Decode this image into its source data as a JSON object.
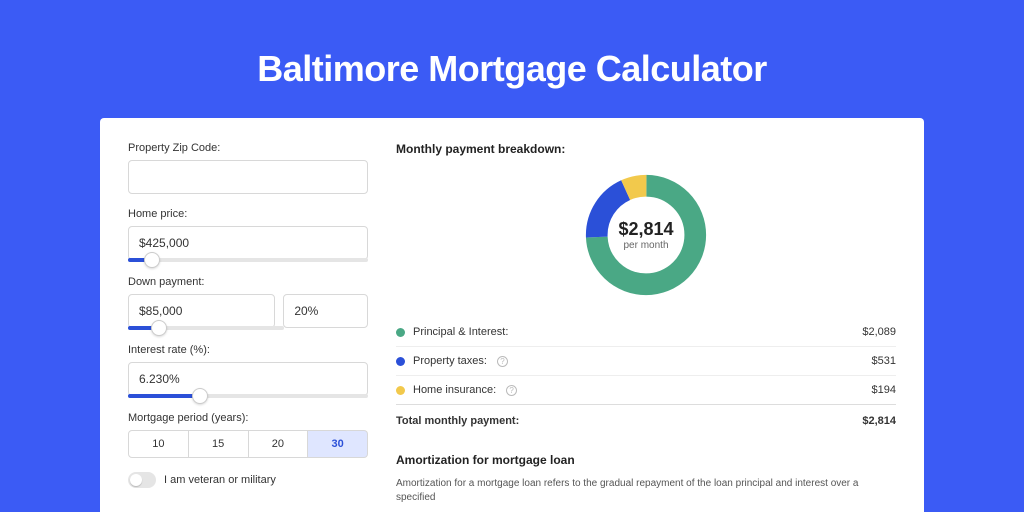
{
  "title": "Baltimore Mortgage Calculator",
  "form": {
    "zip_label": "Property Zip Code:",
    "zip_value": "",
    "home_price_label": "Home price:",
    "home_price_value": "$425,000",
    "home_price_slider_pct": 10,
    "down_payment_label": "Down payment:",
    "down_payment_value": "$85,000",
    "down_payment_pct": "20%",
    "down_payment_slider_pct": 20,
    "interest_label": "Interest rate (%):",
    "interest_value": "6.230%",
    "interest_slider_pct": 30,
    "period_label": "Mortgage period (years):",
    "periods": [
      "10",
      "15",
      "20",
      "30"
    ],
    "period_selected": "30",
    "veteran_label": "I am veteran or military"
  },
  "breakdown": {
    "heading": "Monthly payment breakdown:",
    "center_amount": "$2,814",
    "center_sub": "per month",
    "items": [
      {
        "label": "Principal & Interest:",
        "value": "$2,089",
        "color": "#4aa885",
        "info": false
      },
      {
        "label": "Property taxes:",
        "value": "$531",
        "color": "#2b50d8",
        "info": true
      },
      {
        "label": "Home insurance:",
        "value": "$194",
        "color": "#f2c94c",
        "info": true
      }
    ],
    "total_label": "Total monthly payment:",
    "total_value": "$2,814"
  },
  "amort": {
    "heading": "Amortization for mortgage loan",
    "text": "Amortization for a mortgage loan refers to the gradual repayment of the loan principal and interest over a specified"
  },
  "chart_data": {
    "type": "pie",
    "title": "Monthly payment breakdown",
    "series": [
      {
        "name": "Principal & Interest",
        "value": 2089,
        "color": "#4aa885"
      },
      {
        "name": "Property taxes",
        "value": 531,
        "color": "#2b50d8"
      },
      {
        "name": "Home insurance",
        "value": 194,
        "color": "#f2c94c"
      }
    ],
    "total": 2814,
    "unit": "USD per month",
    "donut": true
  }
}
